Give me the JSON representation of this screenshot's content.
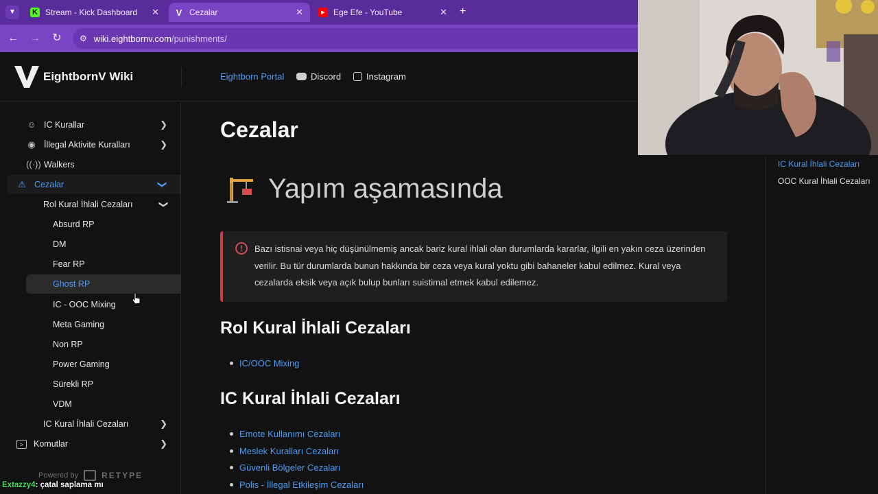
{
  "browser": {
    "tabs": [
      {
        "title": "Stream - Kick Dashboard",
        "favicon": "kick-icon",
        "active": false
      },
      {
        "title": "Cezalar",
        "favicon": "v-logo-icon",
        "active": true
      },
      {
        "title": "Ege Efe - YouTube",
        "favicon": "youtube-icon",
        "active": false
      }
    ],
    "url_domain": "wiki.eightbornv.com",
    "url_path": "/punishments/"
  },
  "site": {
    "brand": "EightbornV Wiki",
    "top_links": [
      {
        "label": "Eightborn Portal",
        "icon": ""
      },
      {
        "label": "Discord",
        "icon": "discord-icon"
      },
      {
        "label": "Instagram",
        "icon": "instagram-icon"
      }
    ]
  },
  "sidebar": {
    "items": [
      {
        "label": "IC Kurallar",
        "icon": "users-icon"
      },
      {
        "label": "İllegal Aktivite Kuralları",
        "icon": "eye-icon"
      },
      {
        "label": "Walkers",
        "icon": "broadcast-icon"
      },
      {
        "label": "Cezalar",
        "icon": "warning-icon"
      },
      {
        "label": "Rol Kural İhlali Cezaları"
      },
      {
        "label": "Absurd RP"
      },
      {
        "label": "DM"
      },
      {
        "label": "Fear RP"
      },
      {
        "label": "Ghost RP"
      },
      {
        "label": "IC - OOC Mixing"
      },
      {
        "label": "Meta Gaming"
      },
      {
        "label": "Non RP"
      },
      {
        "label": "Power Gaming"
      },
      {
        "label": "Sürekli RP"
      },
      {
        "label": "VDM"
      },
      {
        "label": "IC Kural İhlali Cezaları"
      },
      {
        "label": "Komutlar",
        "icon": "terminal-icon"
      }
    ],
    "powered_by": "Powered by",
    "powered_brand": "RETYPE"
  },
  "main": {
    "title": "Cezalar",
    "construction": "Yapım aşamasında",
    "alert": "Bazı istisnai veya hiç düşünülmemiş ancak bariz kural ihlali olan durumlarda kararlar, ilgili en yakın ceza üzerinden verilir. Bu tür durumlarda bunun hakkında bir ceza veya kural yoktu gibi bahaneler kabul edilmez. Kural veya cezalarda eksik veya açık bulup bunları suistimal etmek kabul edilemez.",
    "section1": "Rol Kural İhlali Cezaları",
    "section1_links": [
      "IC/OOC Mixing"
    ],
    "section2": "IC Kural İhlali Cezaları",
    "section2_links": [
      "Emote Kullanımı Cezaları",
      "Meslek Kuralları Cezaları",
      "Güvenli Bölgeler Cezaları",
      "Polis - İllegal Etkileşim Cezaları"
    ]
  },
  "toc": {
    "items": [
      "IC Kural İhlali Cezaları",
      "OOC Kural İhlali Cezaları"
    ]
  },
  "chat": {
    "user": "Extazzy4",
    "message": ": çatal saplama mı"
  },
  "colors": {
    "accent": "#4d9cf5",
    "alert": "#c7404a",
    "browser": "#7a44c4"
  }
}
